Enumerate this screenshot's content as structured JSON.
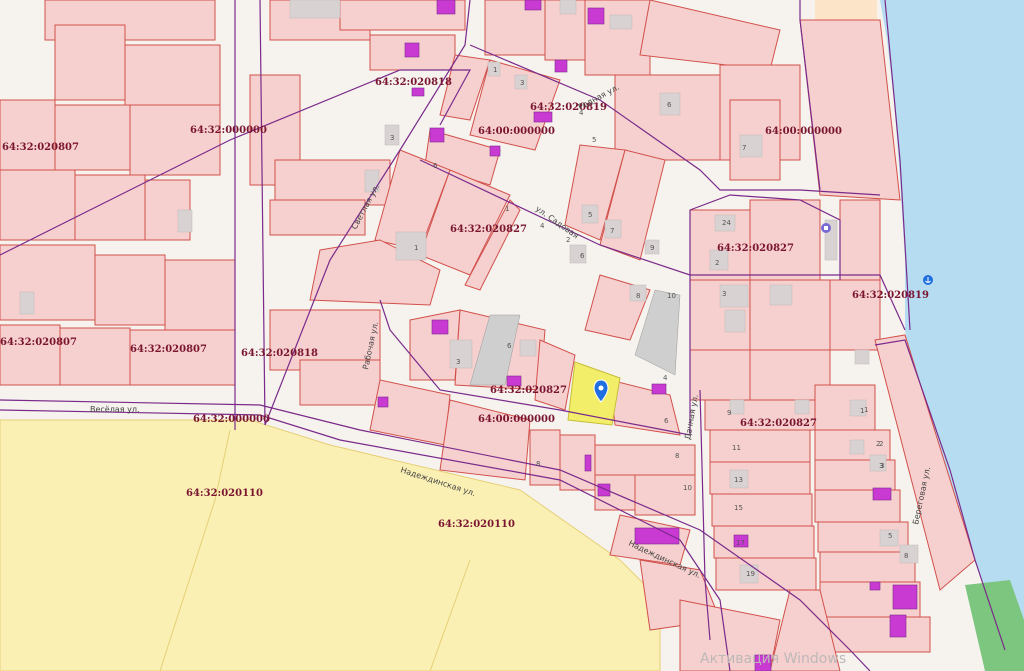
{
  "cadastral_labels": [
    {
      "id": "c1",
      "text": "64:32:020818"
    },
    {
      "id": "c2",
      "text": "64:32:020819"
    },
    {
      "id": "c3",
      "text": "64:00:000000"
    },
    {
      "id": "c4",
      "text": "64:32:000000"
    },
    {
      "id": "c5",
      "text": "64:32:020807"
    },
    {
      "id": "c6",
      "text": "64:32:020827"
    },
    {
      "id": "c7",
      "text": "64:00:000000"
    },
    {
      "id": "c8",
      "text": "64:32:020827"
    },
    {
      "id": "c9",
      "text": "64:32:020819"
    },
    {
      "id": "c10",
      "text": "64:32:020807"
    },
    {
      "id": "c11",
      "text": "64:32:020807"
    },
    {
      "id": "c12",
      "text": "64:32:020818"
    },
    {
      "id": "c13",
      "text": "64:32:020827"
    },
    {
      "id": "c14",
      "text": "64:00:000000"
    },
    {
      "id": "c15",
      "text": "64:32:020827"
    },
    {
      "id": "c16",
      "text": "64:32:000000"
    },
    {
      "id": "c17",
      "text": "64:32:020110"
    },
    {
      "id": "c18",
      "text": "64:32:020110"
    }
  ],
  "streets": {
    "vesyolaya": "Весёлая ул.",
    "nadezhdinskaya": "Надеждинская ул.",
    "nadezhdinskaya2": "Надеждинская ул.",
    "dachnaya": "Дачная ул.",
    "beregovaya": "Береговая ул.",
    "rabochaya": "Рабочая ул.",
    "svetlaya": "Светлая ул.",
    "rodnaya": "Родная ул.",
    "sadovaya": "ул. Садовая"
  },
  "house_numbers": [
    "1",
    "3",
    "1",
    "3",
    "5",
    "7",
    "9",
    "2",
    "4",
    "6",
    "8",
    "10",
    "24",
    "2",
    "3",
    "1",
    "2",
    "3",
    "4",
    "6",
    "8",
    "9",
    "11",
    "13",
    "15",
    "17",
    "19",
    "6",
    "8",
    "10",
    "6",
    "4",
    "3",
    "5",
    "7",
    "1",
    "1",
    "2",
    "3",
    "5",
    "6",
    "8"
  ],
  "watermark": "Активация Windows",
  "colors": {
    "parcel_fill": "#f6d0cf",
    "parcel_stroke": "#d2504b",
    "quarter_border": "#7a2a8a",
    "water": "#b6dcf1",
    "field": "#fbf0b4",
    "green": "#7cc67f",
    "selected_parcel": "#f2ee6a",
    "building": "#d8d2d2",
    "registered_building": "#c93ad3",
    "marker": "#1f6fe0"
  },
  "icons": [
    "location-marker-icon",
    "anchor-icon",
    "shop-pin-icon"
  ]
}
